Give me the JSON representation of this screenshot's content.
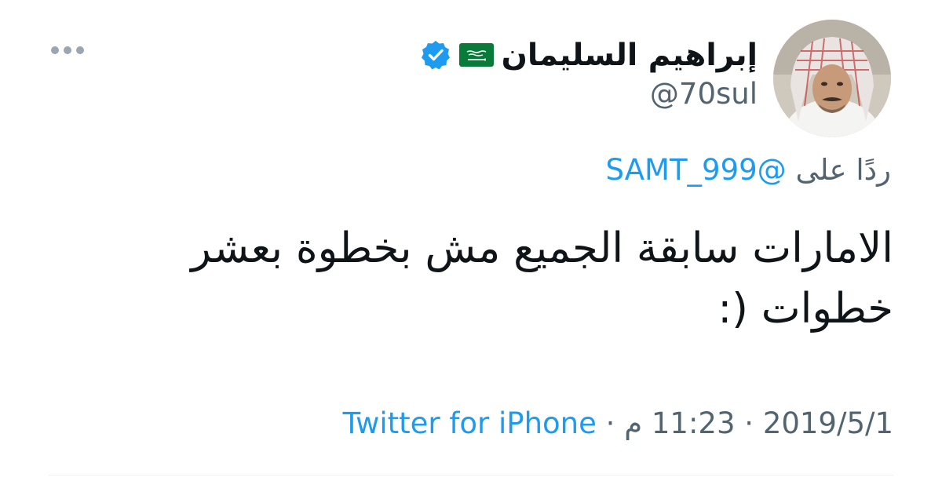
{
  "tweet": {
    "author": {
      "display_name": "إبراهيم السليمان",
      "handle": "@70sul",
      "verified": true,
      "flag_icon": "saudi-arabia-flag-icon",
      "avatar": "profile-photo-man-in-shemagh"
    },
    "reply_to": {
      "prefix": "ردًا على",
      "mention": "@SAMT_999"
    },
    "text": "الامارات سابقة الجميع مش بخطوة بعشر خطوات (:",
    "meta": {
      "date": "2019/5/1",
      "separator": "·",
      "time": "11:23 م",
      "source": "Twitter for iPhone"
    },
    "more_icon": "ellipsis-icon"
  },
  "colors": {
    "text_primary": "#0f1419",
    "text_secondary": "#536471",
    "link": "#1d9bf0",
    "verified": "#1d9bf0",
    "divider": "#eff3f4"
  }
}
